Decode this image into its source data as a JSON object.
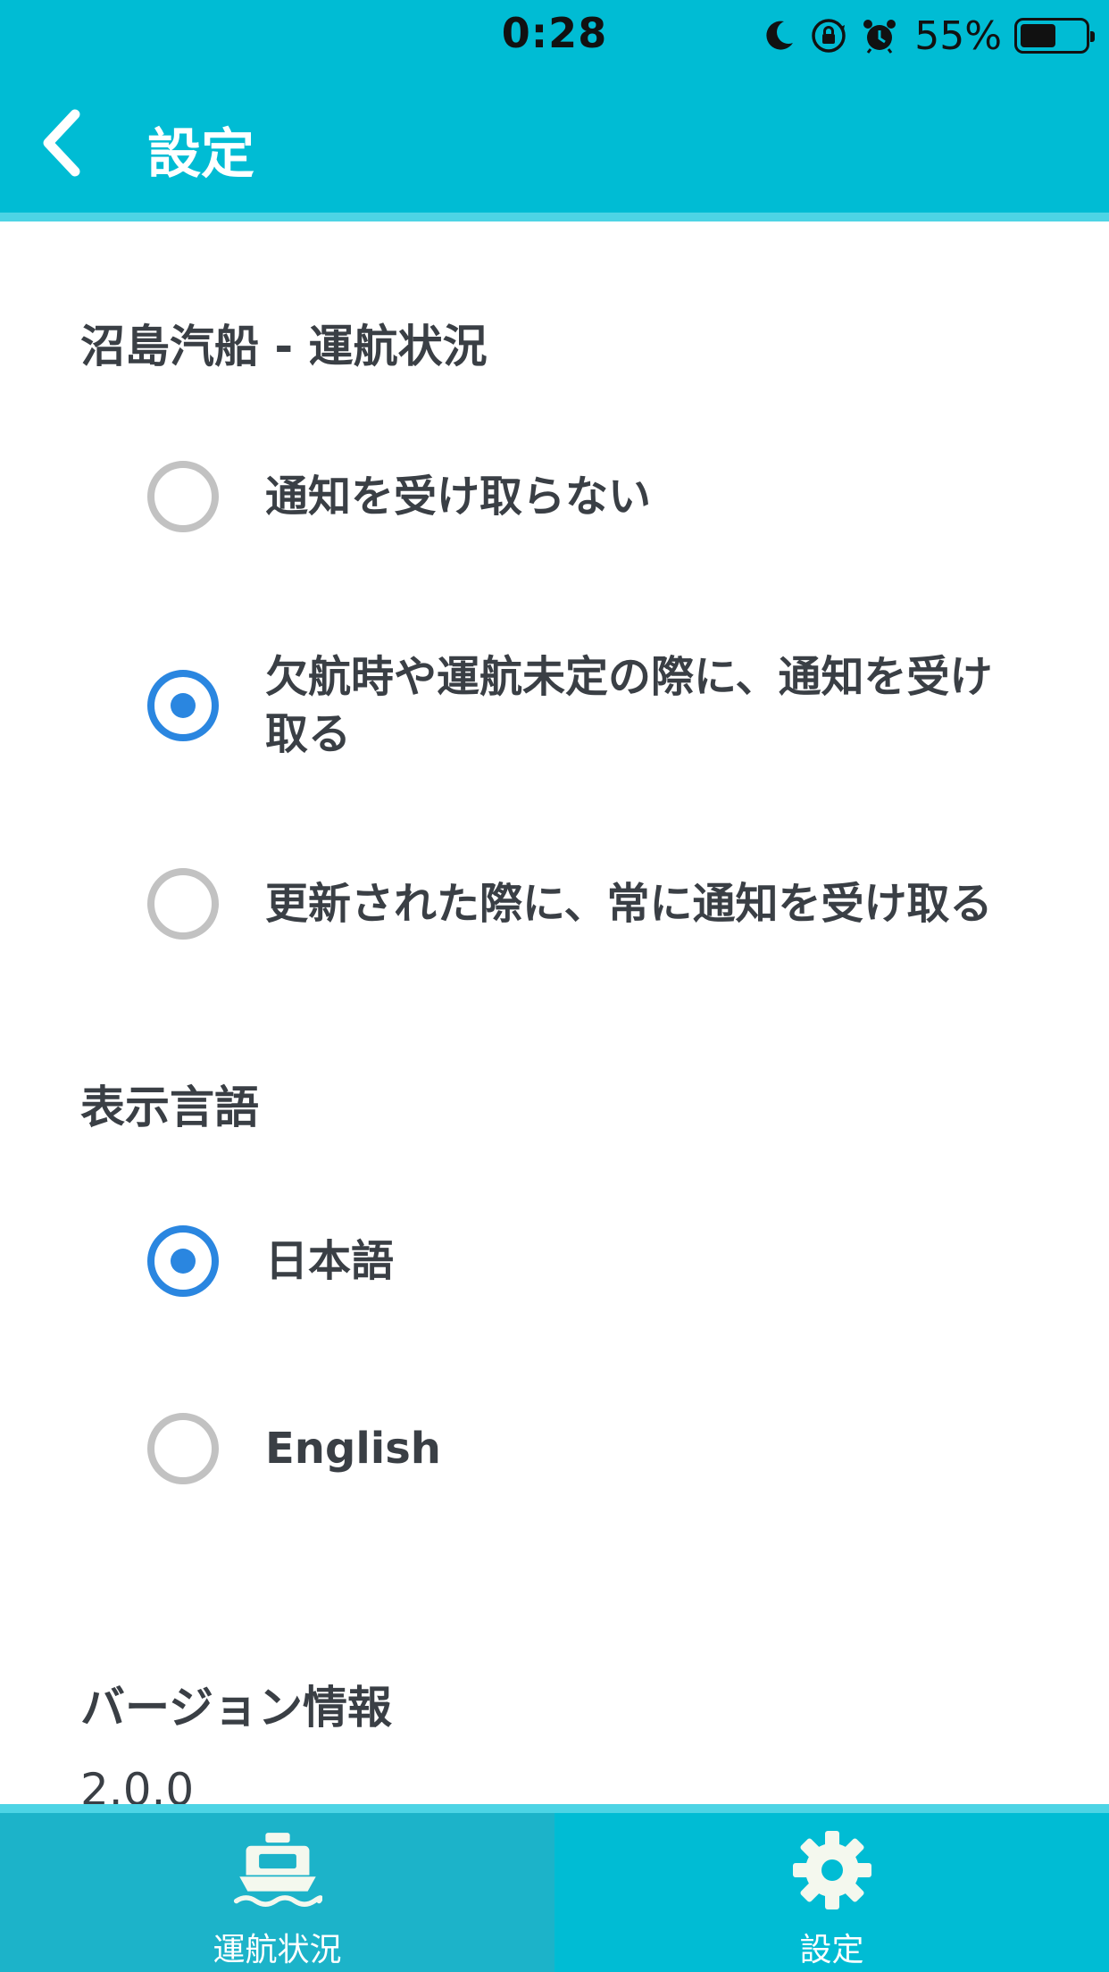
{
  "status_bar": {
    "time": "0:28",
    "battery_percent_label": "55%",
    "battery_level": 0.55,
    "icons": [
      "moon-icon",
      "orientation-lock-icon",
      "alarm-icon",
      "battery-icon"
    ]
  },
  "header": {
    "title": "設定",
    "back_icon": "chevron-left-icon"
  },
  "notification_section": {
    "title": "沼島汽船 - 運航状況",
    "options": [
      {
        "label": "通知を受け取らない",
        "selected": false
      },
      {
        "label": "欠航時や運航未定の際に、通知を受け取る",
        "selected": true
      },
      {
        "label": "更新された際に、常に通知を受け取る",
        "selected": false
      }
    ]
  },
  "language_section": {
    "title": "表示言語",
    "options": [
      {
        "label": "日本語",
        "selected": true
      },
      {
        "label": "English",
        "selected": false
      }
    ]
  },
  "version_section": {
    "title": "バージョン情報",
    "value": "2.0.0"
  },
  "tabbar": {
    "tabs": [
      {
        "label": "運航状況",
        "icon": "ferry-icon",
        "active": true
      },
      {
        "label": "設定",
        "icon": "gear-icon",
        "active": false
      }
    ]
  },
  "colors": {
    "primary": "#00bcd4",
    "primary_light": "#4dd4e5",
    "active_tab": "#1cb3c9",
    "radio_selected": "#2a86e0",
    "radio_unselected": "#c2c2c2",
    "text": "#3a3f45"
  }
}
